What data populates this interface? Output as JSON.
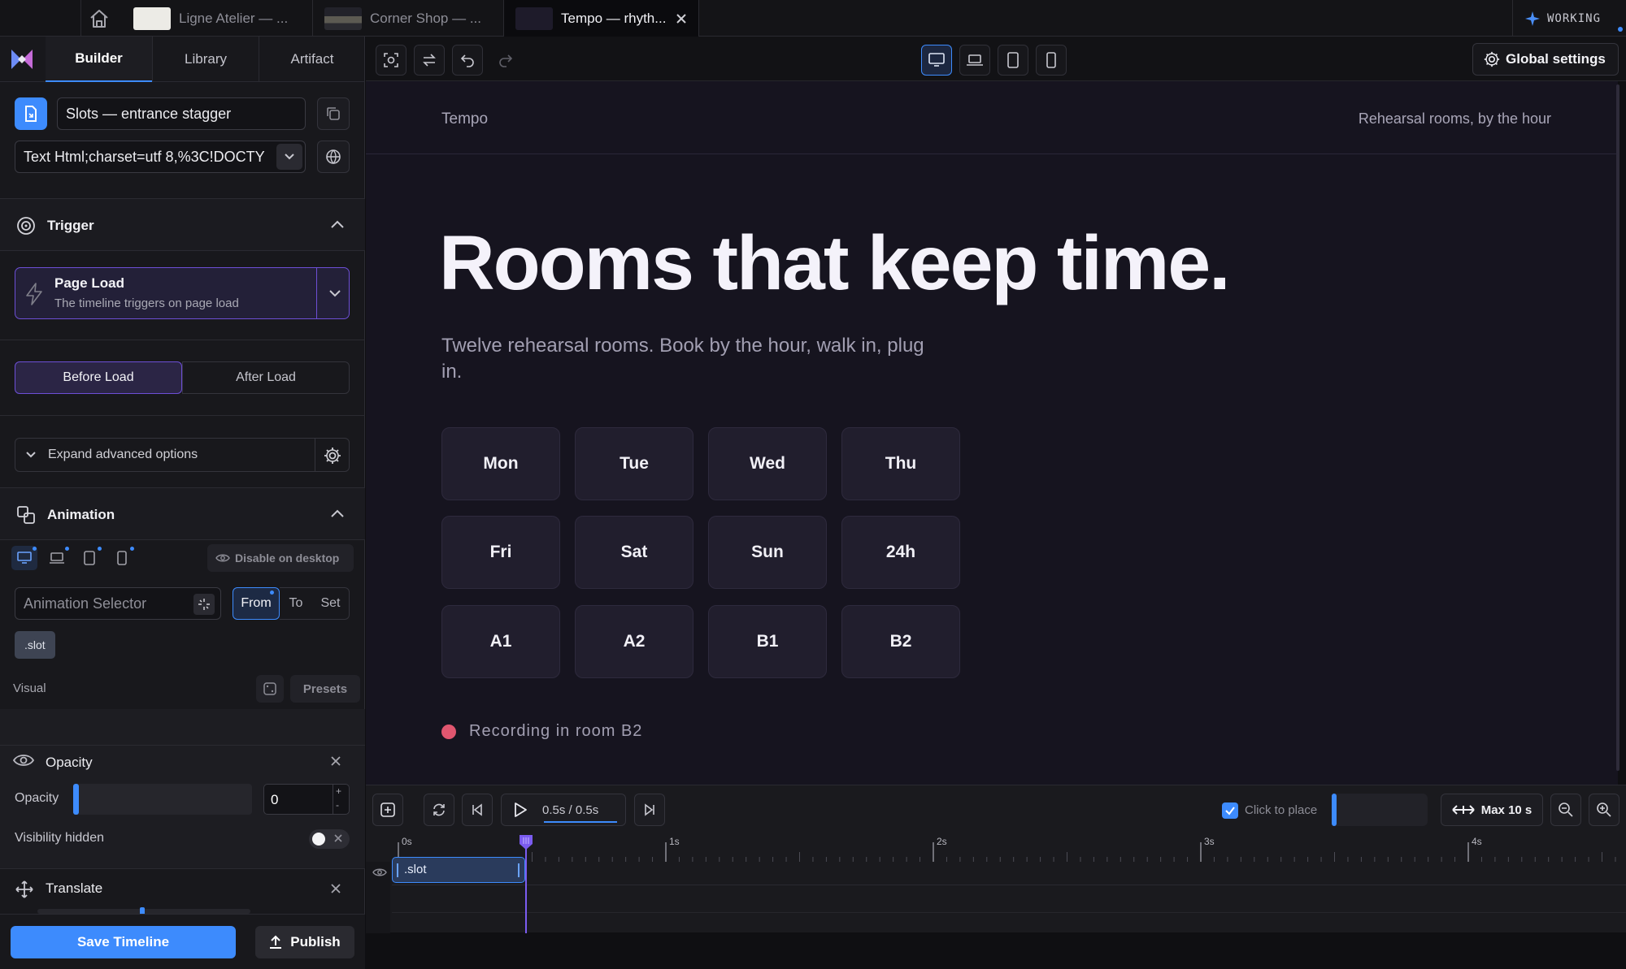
{
  "tabs": [
    {
      "label": "Ligne Atelier — ..."
    },
    {
      "label": "Corner Shop — ..."
    },
    {
      "label": "Tempo — rhyth..."
    }
  ],
  "status": {
    "label": "WORKING"
  },
  "panel_tabs": [
    "Builder",
    "Library",
    "Artifact"
  ],
  "timeline_name": "Slots — entrance stagger",
  "url_field": "Text Html;charset=utf 8,%3C!DOCTY",
  "trigger": {
    "title": "Trigger",
    "type": "Page Load",
    "description": "The timeline triggers on page load",
    "before_label": "Before Load",
    "after_label": "After Load",
    "advanced_label": "Expand advanced options"
  },
  "animation": {
    "title": "Animation",
    "disable_label": "Disable on desktop",
    "selector_placeholder": "Animation Selector",
    "modes": [
      "From",
      "To",
      "Set"
    ],
    "selector_chip": ".slot",
    "visual_label": "Visual",
    "presets_label": "Presets",
    "opacity_title": "Opacity",
    "opacity_label": "Opacity",
    "opacity_value": "0",
    "opacity_level": 0,
    "visibility_label": "Visibility hidden",
    "translate_title": "Translate"
  },
  "footer": {
    "save_label": "Save Timeline",
    "publish_label": "Publish"
  },
  "global_settings": "Global settings",
  "site": {
    "brand": "Tempo",
    "tagline": "Rehearsal rooms, by the hour",
    "headline": "Rooms that keep time.",
    "subhead": "Twelve rehearsal rooms. Book by the hour, walk in, plug in.",
    "slots": [
      "Mon",
      "Tue",
      "Wed",
      "Thu",
      "Fri",
      "Sat",
      "Sun",
      "24h",
      "A1",
      "A2",
      "B1",
      "B2"
    ],
    "recording": "Recording in room B2"
  },
  "timeline": {
    "time_display": "0.5s / 0.5s",
    "click_to_place": "Click to place",
    "max_label": "Max 10 s",
    "ticks": [
      "0s",
      "1s",
      "2s",
      "3s",
      "4s"
    ],
    "track_label": ".slot"
  },
  "colors": {
    "accent": "#3d8bfd",
    "purple": "#6d4fd6",
    "record": "#e0566f"
  }
}
